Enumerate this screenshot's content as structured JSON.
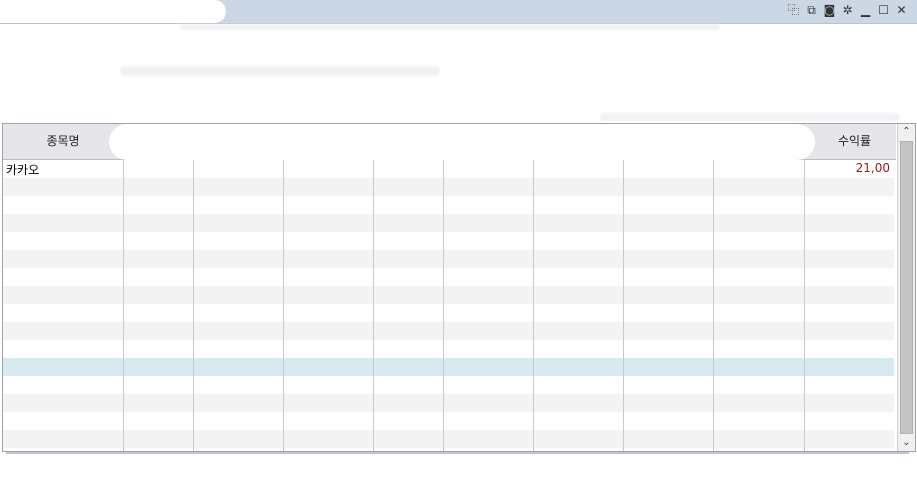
{
  "window": {
    "title_icons": [
      "new-window-icon",
      "copy-icon",
      "camera-icon",
      "settings-gear-icon",
      "minimize-icon",
      "maximize-icon",
      "close-icon"
    ],
    "icon_glyphs": [
      "⿻",
      "⧉",
      "◙",
      "✲",
      "▁",
      "☐",
      "✕"
    ]
  },
  "grid": {
    "headers": {
      "name": "종목명",
      "rate": "수익률"
    },
    "rows": [
      {
        "name": "카카오",
        "rate": "21,00"
      }
    ],
    "selected_row_index": 11
  },
  "scrollbar": {
    "up": "⌃",
    "down": "⌄"
  },
  "colors": {
    "titlebar": "#ccd7e6",
    "header_bg": "#e6e6ea",
    "selected_row": "#d7eaf1",
    "rate_text": "#9e1a1a"
  }
}
